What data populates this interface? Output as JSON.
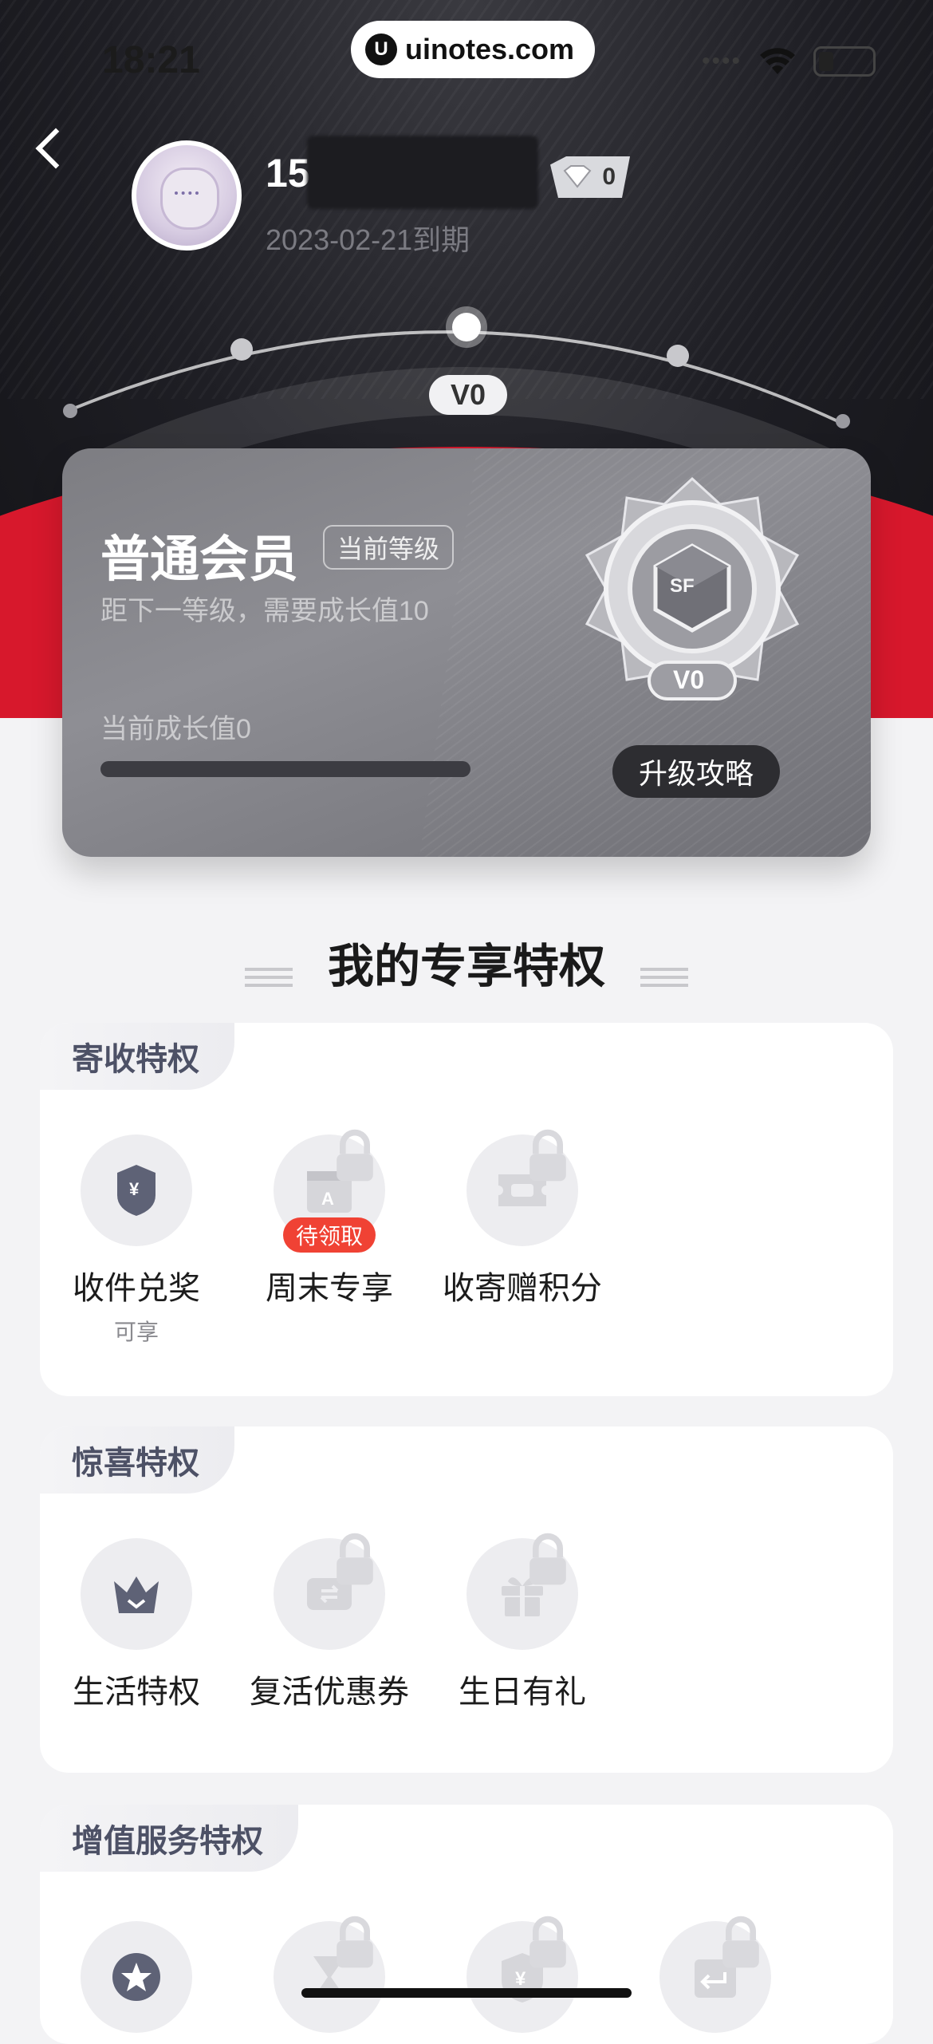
{
  "status_bar": {
    "time": "18:21"
  },
  "watermark": {
    "logo": "U",
    "text": "uinotes.com"
  },
  "profile": {
    "phone_prefix": "15",
    "vip_level_number": "0",
    "expire_text": "2023-02-21到期"
  },
  "level_track": {
    "current_label": "V0"
  },
  "member_card": {
    "title": "普通会员",
    "current_tag": "当前等级",
    "next_level_hint": "距下一等级，需要成长值10",
    "growth_text": "当前成长值0",
    "growth_progress": 0,
    "medal_brand": "SF",
    "medal_level": "V0",
    "upgrade_button": "升级攻略"
  },
  "section": {
    "title": "我的专享特权"
  },
  "panels": [
    {
      "tab": "寄收特权",
      "items": [
        {
          "label": "收件兑奖",
          "sub": "可享",
          "icon": "reward-badge-icon",
          "locked": false,
          "badge": ""
        },
        {
          "label": "周末专享",
          "sub": "",
          "icon": "calendar-icon",
          "locked": true,
          "badge": "待领取"
        },
        {
          "label": "收寄赠积分",
          "sub": "",
          "icon": "ticket-icon",
          "locked": true,
          "badge": ""
        }
      ]
    },
    {
      "tab": "惊喜特权",
      "items": [
        {
          "label": "生活特权",
          "sub": "",
          "icon": "crown-icon",
          "locked": false,
          "badge": ""
        },
        {
          "label": "复活优惠券",
          "sub": "",
          "icon": "coupon-icon",
          "locked": true,
          "badge": ""
        },
        {
          "label": "生日有礼",
          "sub": "",
          "icon": "gift-icon",
          "locked": true,
          "badge": ""
        }
      ]
    },
    {
      "tab": "增值服务特权",
      "items": [
        {
          "label": "",
          "sub": "",
          "icon": "star-icon",
          "locked": false,
          "badge": ""
        },
        {
          "label": "",
          "sub": "",
          "icon": "hourglass-icon",
          "locked": true,
          "badge": ""
        },
        {
          "label": "",
          "sub": "",
          "icon": "shield-yuan-icon",
          "locked": true,
          "badge": ""
        },
        {
          "label": "",
          "sub": "",
          "icon": "return-box-icon",
          "locked": true,
          "badge": ""
        }
      ]
    }
  ],
  "colors": {
    "brand_red": "#d7182c",
    "badge_red": "#f04234",
    "dark": "#1e1e24"
  }
}
